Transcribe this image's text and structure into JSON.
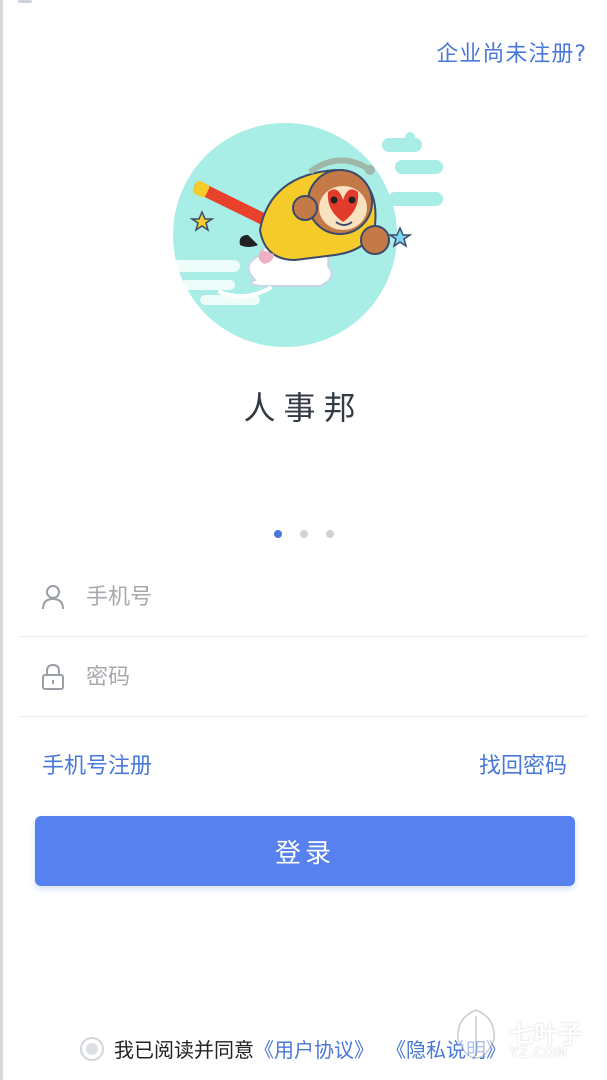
{
  "header": {
    "unregistered_link": "企业尚未注册?"
  },
  "app": {
    "name": "人事邦",
    "logo_icon": "monkey-king-logo"
  },
  "carousel": {
    "pages": 3,
    "active_index": 0
  },
  "form": {
    "phone": {
      "placeholder": "手机号",
      "value": "",
      "icon": "user-icon"
    },
    "password": {
      "placeholder": "密码",
      "value": "",
      "icon": "lock-icon"
    }
  },
  "links": {
    "register": "手机号注册",
    "forgot_password": "找回密码"
  },
  "login_button": "登录",
  "agreement": {
    "text": "我已阅读并同意",
    "user_agreement": "《用户协议》",
    "privacy": "《隐私说明》"
  },
  "watermark": {
    "text": "七叶子",
    "sub": "YZ.COM"
  },
  "colors": {
    "accent": "#4a78d8",
    "button": "#5681ee",
    "logo_bg": "#a8ede6",
    "monkey_yellow": "#f5cc2a"
  }
}
